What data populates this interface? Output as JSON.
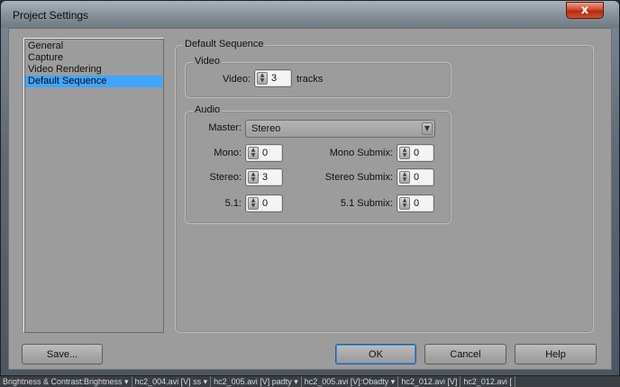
{
  "window": {
    "title": "Project Settings",
    "close_glyph": "x"
  },
  "nav": {
    "items": [
      {
        "label": "General",
        "selected": false
      },
      {
        "label": "Capture",
        "selected": false
      },
      {
        "label": "Video Rendering",
        "selected": false
      },
      {
        "label": "Default Sequence",
        "selected": true
      }
    ]
  },
  "default_sequence": {
    "legend": "Default Sequence",
    "video": {
      "legend": "Video",
      "video_label": "Video:",
      "video_value": "3",
      "tracks_label": "tracks"
    },
    "audio": {
      "legend": "Audio",
      "master_label": "Master:",
      "master_value": "Stereo",
      "mono_label": "Mono:",
      "mono_value": "0",
      "mono_submix_label": "Mono Submix:",
      "mono_submix_value": "0",
      "stereo_label": "Stereo:",
      "stereo_value": "3",
      "stereo_submix_label": "Stereo Submix:",
      "stereo_submix_value": "0",
      "five_one_label": "5.1:",
      "five_one_value": "0",
      "five_one_submix_label": "5.1 Submix:",
      "five_one_submix_value": "0"
    }
  },
  "buttons": {
    "save": "Save...",
    "ok": "OK",
    "cancel": "Cancel",
    "help": "Help"
  },
  "background_strip": [
    "Brightness & Contrast:Brightness ▾",
    "hc2_004.avi [V] ss ▾",
    "hc2_005.avi [V] padty ▾",
    "hc2_005.avi [V]:Obadty ▾",
    "hc2_012.avi [V]",
    "hc2_012.avi ["
  ],
  "colors": {
    "selection": "#3ea6ff",
    "panel": "#9c9c9c",
    "close": "#c9512f"
  }
}
